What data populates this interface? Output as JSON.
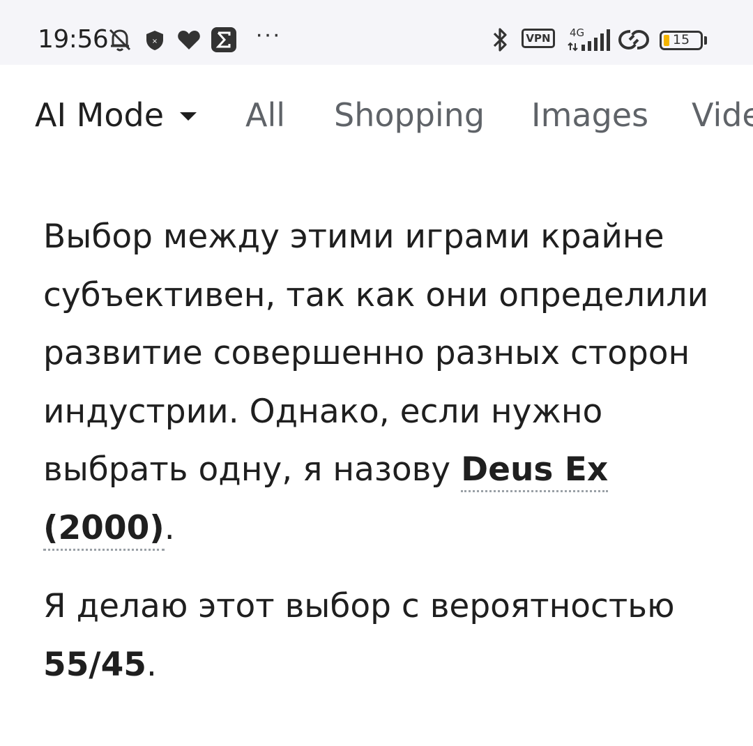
{
  "status_bar": {
    "time": "19:56",
    "icons": [
      "bell-off-icon",
      "shield-icon",
      "heart-icon",
      "sigma-app-icon",
      "more-dots-icon",
      "bluetooth-icon",
      "vpn-icon",
      "signal-icon",
      "sync-icon",
      "battery-icon"
    ],
    "more": "···",
    "vpn_label": "VPN",
    "network": "4G",
    "battery_level": "15",
    "battery_fraction": 0.15,
    "battery_color": "#f4b400"
  },
  "tabs": [
    {
      "label": "AI Mode",
      "active": true
    },
    {
      "label": "All",
      "active": false
    },
    {
      "label": "Shopping",
      "active": false
    },
    {
      "label": "Images",
      "active": false
    },
    {
      "label": "Videos",
      "active": false
    }
  ],
  "answer": {
    "p1_text": "Выбор между этими играми крайне субъективен, так как они определили развитие совершенно разных сторон индустрии. Однако, если нужно выбрать одну, я назову ",
    "p1_link": "Deus Ex (2000)",
    "p1_end": ".",
    "p2_text": "Я делаю этот выбор с вероятностью ",
    "p2_bold": "55/45",
    "p2_end": "."
  }
}
